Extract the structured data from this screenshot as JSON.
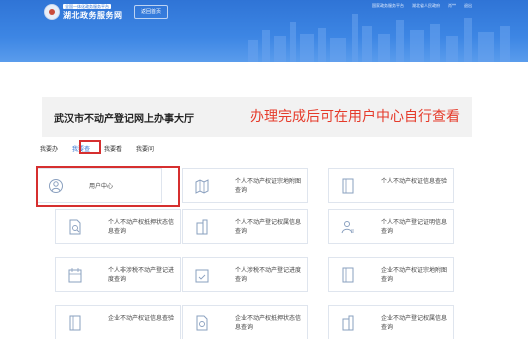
{
  "header": {
    "logo_small": "全国一体化政务服务平台",
    "logo_main": "湖北政务服务网",
    "nav_button": "返回首页",
    "top_links": [
      "国家政务服务平台",
      "湖北省人民政府",
      "肖**",
      "退出"
    ]
  },
  "banner": {
    "title": "武汉市不动产登记网上办事大厅",
    "note": "办理完成后可在用户中心自行查看"
  },
  "tabs": [
    {
      "label": "我要办",
      "active": false
    },
    {
      "label": "我要查",
      "active": true
    },
    {
      "label": "我要看",
      "active": false
    },
    {
      "label": "我要问",
      "active": false
    }
  ],
  "cards": [
    {
      "label": "用户中心",
      "icon": "user-icon"
    },
    {
      "label": "个人不动产权证宗地附图查询",
      "icon": "map-icon"
    },
    {
      "label": "个人不动产权证信息查验",
      "icon": "book-icon"
    },
    {
      "label": "个人不动产权抵押状态信息查询",
      "icon": "document-search-icon"
    },
    {
      "label": "个人不动产登记权属信息查询",
      "icon": "building-icon"
    },
    {
      "label": "个人不动产登记证明信息查询",
      "icon": "person-list-icon"
    },
    {
      "label": "个人非涉税不动产登记进度查询",
      "icon": "calendar-icon"
    },
    {
      "label": "个人涉税不动产登记进度查询",
      "icon": "calendar-check-icon"
    },
    {
      "label": "企业不动产权证宗地附图查询",
      "icon": "book-icon"
    },
    {
      "label": "企业不动产权证信息查验",
      "icon": "book-icon"
    },
    {
      "label": "企业不动产权抵押状态信息查询",
      "icon": "document-search-icon"
    },
    {
      "label": "企业不动产登记权属信息查询",
      "icon": "building-icon"
    }
  ],
  "colors": {
    "header": "#2f74d6",
    "accent": "#2c6fd1",
    "highlight": "#d62f2f",
    "note": "#e53b2b"
  }
}
